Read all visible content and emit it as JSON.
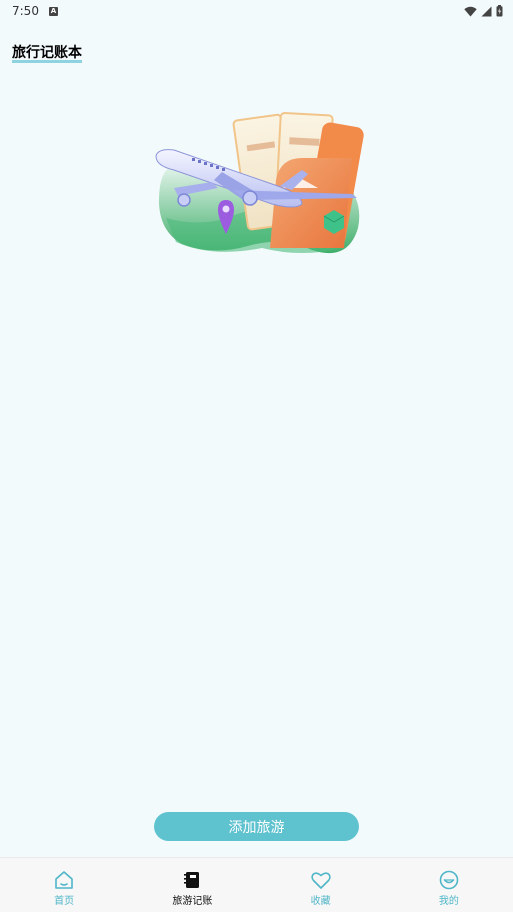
{
  "status_bar": {
    "time": "7:50"
  },
  "header": {
    "title": "旅行记账本"
  },
  "main": {
    "illustration": "airplane-tickets-illustration",
    "add_button_label": "添加旅游"
  },
  "bottom_nav": {
    "items": [
      {
        "label": "首页",
        "icon": "home-icon",
        "active": false
      },
      {
        "label": "旅游记账",
        "icon": "notebook-icon",
        "active": true
      },
      {
        "label": "收藏",
        "icon": "heart-icon",
        "active": false
      },
      {
        "label": "我的",
        "icon": "smile-face-icon",
        "active": false
      }
    ]
  },
  "colors": {
    "background": "#f3fafc",
    "accent": "#5fc2cf",
    "inactive_nav": "#4fb6c8",
    "active_nav": "#111111"
  }
}
